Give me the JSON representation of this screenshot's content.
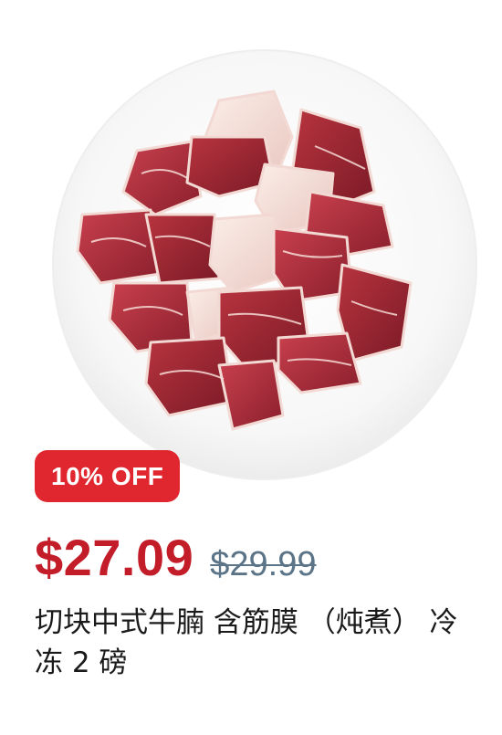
{
  "product": {
    "image_alt": "Cut beef brisket chunks on a white plate",
    "discount_label": "10% OFF",
    "price_current": "$27.09",
    "price_original": "$29.99",
    "title": "切块中式牛腩 含筋膜 （炖煮） 冷冻 2 磅"
  },
  "colors": {
    "badge_bg": "#e0262e",
    "price_current": "#c41d2a",
    "price_original": "#5b7487"
  }
}
